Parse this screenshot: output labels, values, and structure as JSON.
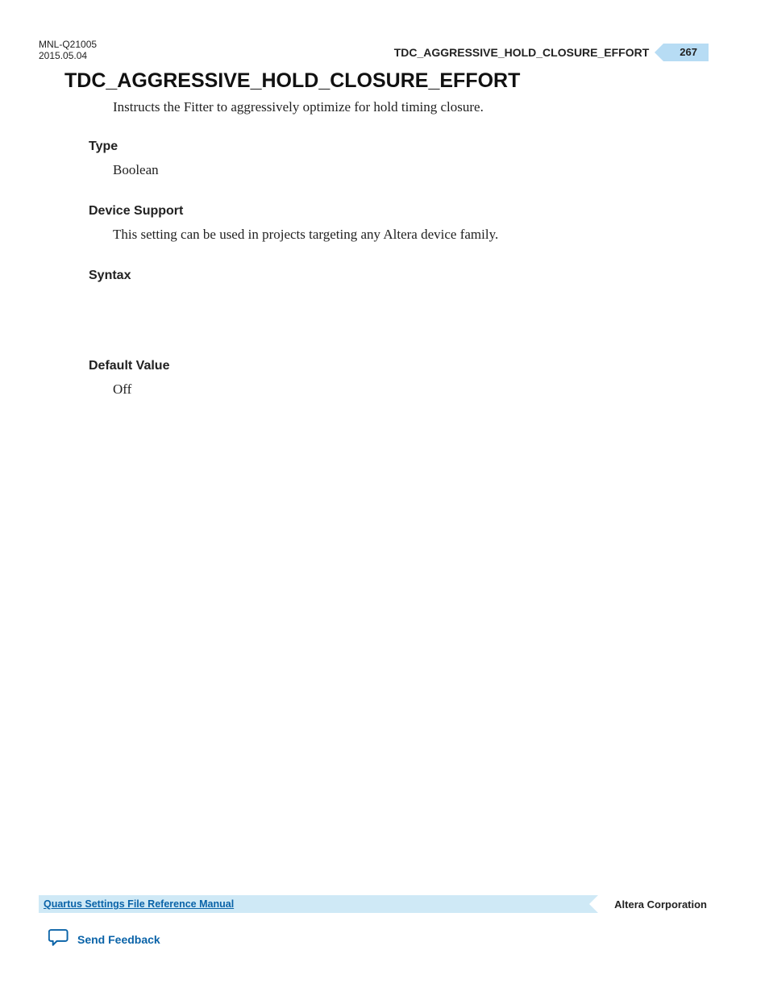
{
  "header": {
    "doc_id": "MNL-Q21005",
    "date": "2015.05.04",
    "running_title": "TDC_AGGRESSIVE_HOLD_CLOSURE_EFFORT",
    "page_number": "267"
  },
  "topic": {
    "title": "TDC_AGGRESSIVE_HOLD_CLOSURE_EFFORT",
    "lead": "Instructs the Fitter to aggressively optimize for hold timing closure."
  },
  "sections": {
    "type": {
      "heading": "Type",
      "body": "Boolean"
    },
    "device_support": {
      "heading": "Device Support",
      "body": "This setting can be used in projects targeting any Altera device family."
    },
    "syntax": {
      "heading": "Syntax",
      "body": ""
    },
    "default_value": {
      "heading": "Default Value",
      "body": "Off"
    }
  },
  "footer": {
    "manual_title": "Quartus Settings File Reference Manual",
    "company": "Altera Corporation",
    "feedback_label": "Send Feedback"
  }
}
